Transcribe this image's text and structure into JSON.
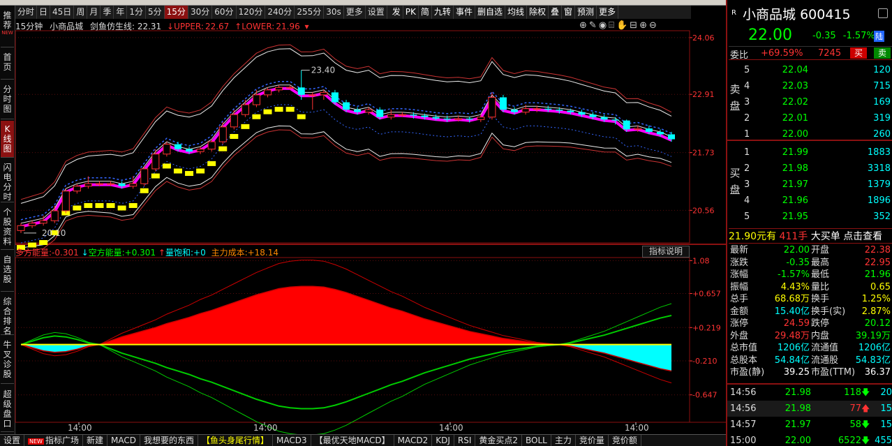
{
  "toolbar": {
    "periods": [
      "分时",
      "日",
      "45日",
      "周",
      "月",
      "季",
      "年",
      "1分",
      "5分",
      "15分",
      "30分",
      "60分",
      "120分",
      "240分",
      "255分",
      "30s",
      "更多",
      "设置"
    ],
    "active_period": "15分",
    "right_items": [
      "发",
      "PK",
      "简",
      "九转",
      "事件",
      "删自选",
      "均线",
      "除权",
      "叠",
      "窗",
      "预测",
      "更多"
    ]
  },
  "sidebar": [
    {
      "label": "推荐",
      "new": "NEW"
    },
    {
      "label": "首页"
    },
    {
      "label": "分时图"
    },
    {
      "label": "K线图",
      "active": true
    },
    {
      "label": "闪电分时"
    },
    {
      "label": "个股资料"
    },
    {
      "label": "自选股"
    },
    {
      "label": "综合排名"
    },
    {
      "label": "牛叉诊股"
    },
    {
      "label": "超级盘口"
    }
  ],
  "chart_header": {
    "period": "15分钟",
    "name": "小商品城",
    "indicator": "剑鱼仿生线:",
    "indicator_value": "22.31",
    "upper_label": "UPPER:",
    "upper_value": "22.67",
    "lower_label": "LOWER:",
    "lower_value": "21.96"
  },
  "indicator_header": {
    "bull_label": "多方能量:",
    "bull_value": "-0.301",
    "bear_label": "空方能量:",
    "bear_value": "+0.301",
    "sat_label": "量饱和:",
    "sat_value": "+0",
    "cost_label": "主力成本:",
    "cost_value": "+18.14",
    "desc_button": "指标说明"
  },
  "chart_data": [
    {
      "type": "candlestick",
      "ylim": [
        19.9,
        24.2
      ],
      "y_ticks": [
        "24.06",
        "22.91",
        "21.73",
        "20.56"
      ],
      "x_ticks": [
        "14:00",
        "14:00",
        "14:00",
        "14:00"
      ],
      "annotations": [
        {
          "text": "23.40",
          "note": "high"
        },
        {
          "text": "20.10",
          "note": "low"
        }
      ],
      "candles": [
        [
          20.15,
          20.25,
          20.1,
          20.3
        ],
        [
          20.25,
          20.3,
          20.2,
          20.35
        ],
        [
          20.3,
          20.35,
          20.25,
          20.45
        ],
        [
          20.35,
          20.55,
          20.3,
          20.65
        ],
        [
          20.55,
          20.95,
          20.5,
          21.0
        ],
        [
          20.95,
          21.05,
          20.9,
          21.1
        ],
        [
          21.05,
          21.1,
          21.0,
          21.25
        ],
        [
          21.1,
          21.1,
          21.05,
          21.15
        ],
        [
          21.1,
          21.1,
          21.05,
          21.15
        ],
        [
          21.1,
          21.05,
          21.0,
          21.15
        ],
        [
          21.05,
          21.1,
          21.0,
          21.25
        ],
        [
          21.1,
          21.4,
          21.05,
          21.45
        ],
        [
          21.4,
          21.7,
          21.35,
          21.8
        ],
        [
          21.7,
          21.9,
          21.65,
          21.95
        ],
        [
          21.9,
          21.8,
          21.75,
          21.95
        ],
        [
          21.8,
          21.75,
          21.7,
          21.85
        ],
        [
          21.75,
          21.8,
          21.7,
          21.85
        ],
        [
          21.8,
          21.95,
          21.75,
          22.0
        ],
        [
          21.95,
          22.25,
          21.9,
          22.35
        ],
        [
          22.25,
          22.5,
          22.2,
          22.6
        ],
        [
          22.5,
          22.7,
          22.45,
          22.8
        ],
        [
          22.7,
          22.9,
          22.65,
          23.0
        ],
        [
          22.9,
          23.0,
          22.85,
          23.05
        ],
        [
          23.0,
          23.05,
          22.95,
          23.1
        ],
        [
          23.05,
          23.05,
          23.0,
          23.1
        ],
        [
          23.05,
          22.9,
          22.8,
          23.4
        ],
        [
          22.9,
          22.9,
          22.6,
          22.95
        ],
        [
          22.9,
          22.95,
          22.8,
          23.0
        ],
        [
          22.95,
          22.75,
          22.7,
          23.0
        ],
        [
          22.75,
          22.6,
          22.55,
          22.8
        ],
        [
          22.6,
          22.55,
          22.5,
          22.65
        ],
        [
          22.55,
          22.6,
          22.5,
          22.65
        ],
        [
          22.6,
          22.45,
          22.4,
          22.65
        ],
        [
          22.45,
          22.5,
          22.4,
          22.6
        ],
        [
          22.5,
          22.5,
          22.45,
          22.55
        ],
        [
          22.5,
          22.48,
          22.42,
          22.55
        ],
        [
          22.48,
          22.45,
          22.4,
          22.52
        ],
        [
          22.45,
          22.42,
          22.38,
          22.5
        ],
        [
          22.42,
          22.4,
          22.35,
          22.48
        ],
        [
          22.4,
          22.42,
          22.36,
          22.48
        ],
        [
          22.42,
          22.4,
          22.34,
          22.46
        ],
        [
          22.4,
          22.45,
          22.35,
          22.5
        ],
        [
          22.45,
          22.85,
          22.4,
          22.95
        ],
        [
          22.85,
          22.6,
          22.55,
          22.9
        ],
        [
          22.6,
          22.55,
          22.5,
          22.65
        ],
        [
          22.55,
          22.62,
          22.5,
          22.7
        ],
        [
          22.62,
          22.62,
          22.55,
          22.68
        ],
        [
          22.62,
          22.6,
          22.55,
          22.68
        ],
        [
          22.6,
          22.58,
          22.52,
          22.65
        ],
        [
          22.58,
          22.55,
          22.5,
          22.62
        ],
        [
          22.55,
          22.5,
          22.45,
          22.6
        ],
        [
          22.5,
          22.45,
          22.4,
          22.55
        ],
        [
          22.45,
          22.4,
          22.35,
          22.5
        ],
        [
          22.4,
          22.38,
          22.3,
          22.45
        ],
        [
          22.38,
          22.2,
          22.15,
          22.4
        ],
        [
          22.2,
          22.22,
          22.15,
          22.28
        ],
        [
          22.22,
          22.15,
          22.1,
          22.28
        ],
        [
          22.15,
          22.1,
          22.05,
          22.2
        ],
        [
          22.1,
          22.0,
          21.95,
          22.15
        ]
      ]
    },
    {
      "type": "area",
      "ylim": [
        -1.0,
        1.12
      ],
      "y_ticks": [
        "1.08",
        "+0.657",
        "+0.219",
        "-0.210",
        "-0.647"
      ],
      "series": [
        {
          "values": [
            0,
            -0.04,
            -0.08,
            -0.1,
            -0.09,
            -0.06,
            -0.02,
            0,
            0.05,
            0.1,
            0.14,
            0.18,
            0.22,
            0.27,
            0.31,
            0.35,
            0.4,
            0.44,
            0.49,
            0.54,
            0.59,
            0.64,
            0.68,
            0.72,
            0.74,
            0.75,
            0.75,
            0.74,
            0.71,
            0.67,
            0.62,
            0.57,
            0.52,
            0.47,
            0.43,
            0.38,
            0.33,
            0.29,
            0.25,
            0.21,
            0.17,
            0.14,
            0.11,
            0.08,
            0.06,
            0.04,
            0.02,
            0.01,
            0,
            -0.02,
            -0.05,
            -0.08,
            -0.11,
            -0.15,
            -0.19,
            -0.23,
            -0.27,
            -0.31,
            -0.34
          ]
        }
      ]
    }
  ],
  "bottombar": [
    "设置",
    "指标广场",
    "新建",
    "MACD",
    "我想要的东西",
    "【鱼头身尾行情】",
    "MACD3",
    "【最优天地MACD】",
    "MACD2",
    "KDJ",
    "RSI",
    "黄金买点2",
    "BOLL",
    "主力",
    "竞价量",
    "竞价额"
  ],
  "bottom_new": "NEW",
  "bottom_active": "【鱼头身尾行情】",
  "quote": {
    "mark": "R",
    "name": "小商品城",
    "code": "600415",
    "price": "22.00",
    "change": "-0.35",
    "change_pct": "-1.57%",
    "lu": "陆",
    "wb_label": "委比",
    "wb_pct": "+69.59%",
    "wb_count": "7245",
    "buy_btn": "买",
    "sell_btn": "卖",
    "sell_side": "卖盘",
    "buy_side": "买盘",
    "asks": [
      {
        "lv": "5",
        "price": "22.04",
        "vol": "120"
      },
      {
        "lv": "4",
        "price": "22.03",
        "vol": "715"
      },
      {
        "lv": "3",
        "price": "22.02",
        "vol": "169"
      },
      {
        "lv": "2",
        "price": "22.01",
        "vol": "319"
      },
      {
        "lv": "1",
        "price": "22.00",
        "vol": "260"
      }
    ],
    "bids": [
      {
        "lv": "1",
        "price": "21.99",
        "vol": "1883"
      },
      {
        "lv": "2",
        "price": "21.98",
        "vol": "3318"
      },
      {
        "lv": "3",
        "price": "21.97",
        "vol": "1379"
      },
      {
        "lv": "4",
        "price": "21.96",
        "vol": "1896"
      },
      {
        "lv": "5",
        "price": "21.95",
        "vol": "352"
      }
    ],
    "big_order": {
      "price": "21.90元有",
      "hands": "411手",
      "text": "大买单",
      "link": "点击查看"
    },
    "stats": [
      {
        "l1": "最新",
        "v1": "22.00",
        "c1": "g",
        "l2": "开盘",
        "v2": "22.38",
        "c2": "r"
      },
      {
        "l1": "涨跌",
        "v1": "-0.35",
        "c1": "g",
        "l2": "最高",
        "v2": "22.95",
        "c2": "r"
      },
      {
        "l1": "涨幅",
        "v1": "-1.57%",
        "c1": "g",
        "l2": "最低",
        "v2": "21.96",
        "c2": "g"
      },
      {
        "l1": "振幅",
        "v1": "4.43%",
        "c1": "y",
        "l2": "量比",
        "v2": "0.65",
        "c2": "y"
      },
      {
        "l1": "总手",
        "v1": "68.68万",
        "c1": "y",
        "l2": "换手",
        "v2": "1.25%",
        "c2": "y"
      },
      {
        "l1": "金额",
        "v1": "15.40亿",
        "c1": "c",
        "l2": "换手(实)",
        "v2": "2.87%",
        "c2": "y"
      },
      {
        "l1": "涨停",
        "v1": "24.59",
        "c1": "r",
        "l2": "跌停",
        "v2": "20.12",
        "c2": "g"
      },
      {
        "l1": "外盘",
        "v1": "29.48万",
        "c1": "r",
        "l2": "内盘",
        "v2": "39.19万",
        "c2": "g"
      },
      {
        "l1": "总市值",
        "v1": "1206亿",
        "c1": "c",
        "l2": "流通值",
        "v2": "1206亿",
        "c2": "c"
      },
      {
        "l1": "总股本",
        "v1": "54.84亿",
        "c1": "c",
        "l2": "流通股",
        "v2": "54.83亿",
        "c2": "c"
      },
      {
        "l1": "市盈(静)",
        "v1": "39.25",
        "c1": "w",
        "l2": "市盈(TTM)",
        "v2": "36.37",
        "c2": "w"
      }
    ],
    "ticks": [
      {
        "t": "14:56",
        "p": "21.98",
        "v": "118",
        "dir": "down",
        "n": "20"
      },
      {
        "t": "14:56",
        "p": "21.98",
        "v": "77",
        "dir": "up",
        "n": "15"
      },
      {
        "t": "14:57",
        "p": "21.97",
        "v": "58",
        "dir": "down",
        "n": "15"
      },
      {
        "t": "15:00",
        "p": "22.00",
        "v": "6522",
        "dir": "down",
        "n": "455"
      }
    ]
  }
}
